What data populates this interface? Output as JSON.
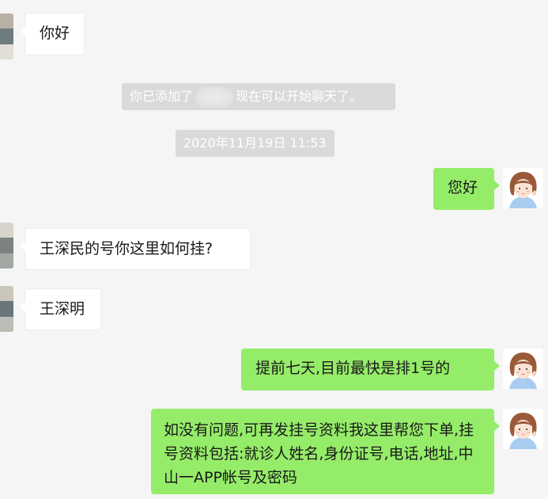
{
  "chat": {
    "system_messages": {
      "added_prefix": "你已添加了",
      "added_suffix": "现在可以开始聊天了。",
      "timestamp": "2020年11月19日 11:53"
    },
    "messages": [
      {
        "side": "in",
        "text": "你好"
      },
      {
        "side": "out",
        "text": "您好"
      },
      {
        "side": "in",
        "text": "王深民的号你这里如何挂?"
      },
      {
        "side": "in",
        "text": "王深明"
      },
      {
        "side": "out",
        "text": "提前七天,目前最快是排1号的"
      },
      {
        "side": "out",
        "text": "如没有问题,可再发挂号资料我这里帮您下单,挂号资料包括:就诊人姓名,身份证号,电话,地址,中山一APP帐号及密码"
      }
    ]
  },
  "colors": {
    "background": "#f5f5f5",
    "bubble_out": "#95ec69",
    "bubble_in": "#ffffff",
    "system_label_bg": "#dadada"
  },
  "icons": {
    "contact_avatar": "contact-avatar",
    "self_avatar": "girl-avatar"
  }
}
